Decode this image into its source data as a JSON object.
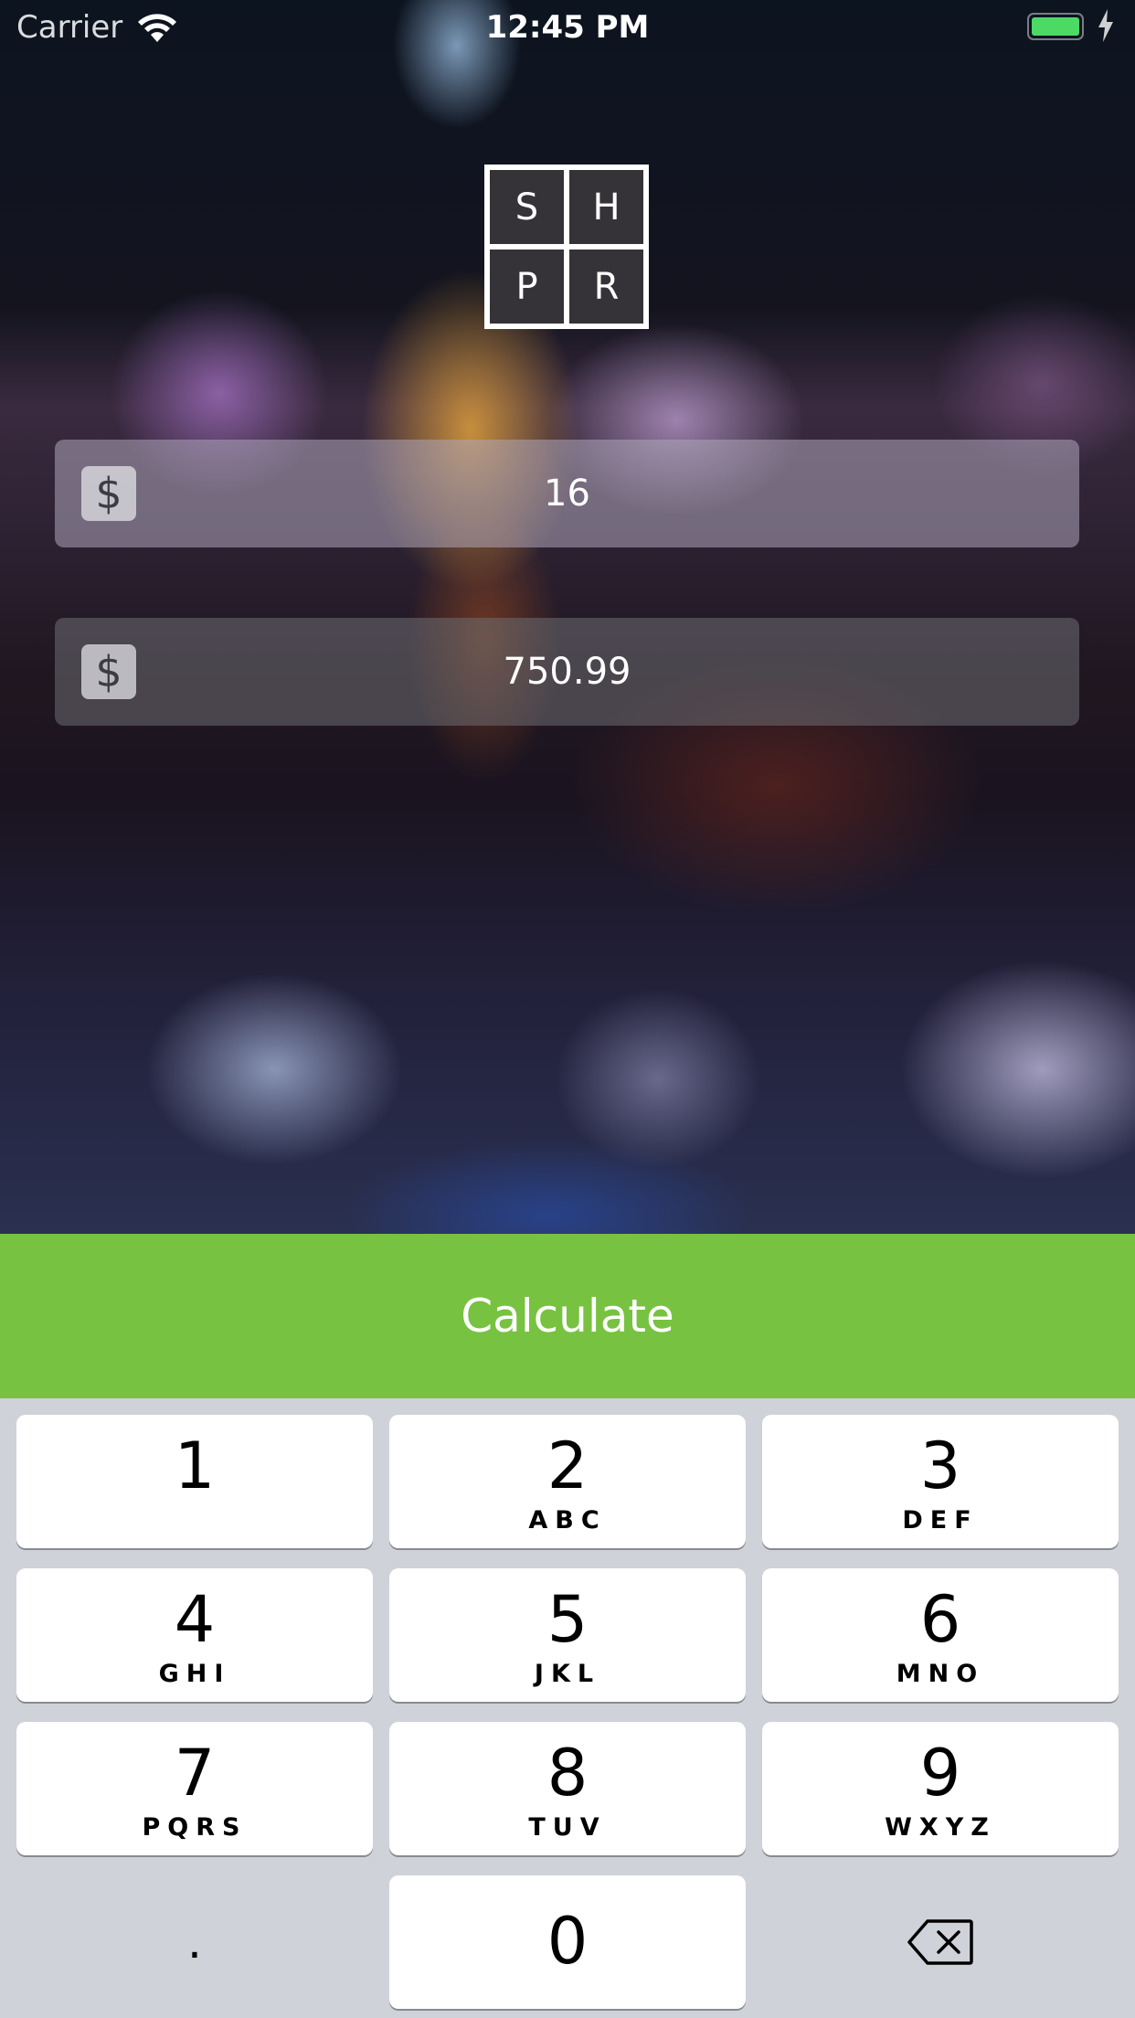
{
  "status_bar": {
    "carrier": "Carrier",
    "time": "12:45 PM",
    "battery_color": "#4cd964"
  },
  "logo": {
    "letters": [
      "S",
      "H",
      "P",
      "R"
    ]
  },
  "fields": [
    {
      "currency_symbol": "$",
      "value": "16"
    },
    {
      "currency_symbol": "$",
      "value": "750.99"
    }
  ],
  "calculate_button": {
    "label": "Calculate",
    "color": "#78c241"
  },
  "keypad": {
    "keys": [
      {
        "digit": "1",
        "letters": ""
      },
      {
        "digit": "2",
        "letters": "ABC"
      },
      {
        "digit": "3",
        "letters": "DEF"
      },
      {
        "digit": "4",
        "letters": "GHI"
      },
      {
        "digit": "5",
        "letters": "JKL"
      },
      {
        "digit": "6",
        "letters": "MNO"
      },
      {
        "digit": "7",
        "letters": "PQRS"
      },
      {
        "digit": "8",
        "letters": "TUV"
      },
      {
        "digit": "9",
        "letters": "WXYZ"
      },
      {
        "digit": "0",
        "letters": ""
      }
    ],
    "decimal_key": ".",
    "delete_icon": "backspace-icon"
  }
}
